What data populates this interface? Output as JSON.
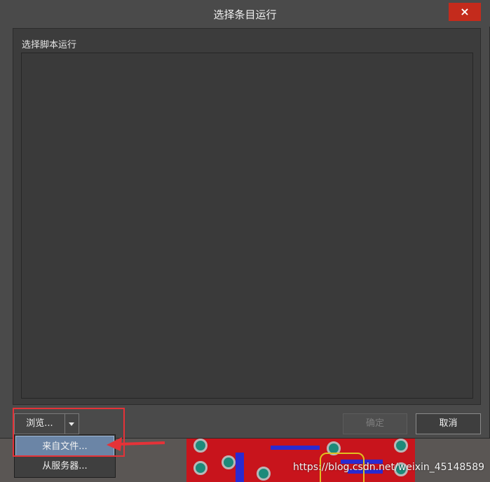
{
  "dialog": {
    "title": "选择条目运行",
    "close_icon": "×",
    "section_label": "选择脚本运行",
    "browse_label": "浏览...",
    "ok_label": "确定",
    "cancel_label": "取消"
  },
  "browse_menu": {
    "items": [
      {
        "label": "来自文件..."
      },
      {
        "label": "从服务器..."
      }
    ]
  },
  "colors": {
    "close_bg": "#c42b1c",
    "menu_active": "#6b85a6",
    "annotation": "#e53238"
  },
  "watermark": "https://blog.csdn.net/weixin_45148589"
}
